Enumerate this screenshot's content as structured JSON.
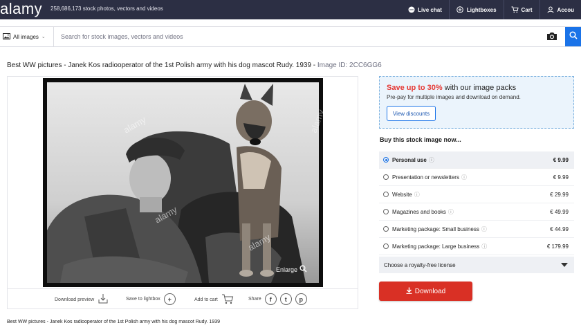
{
  "header": {
    "logo": "alamy",
    "tagline": "258,686,173 stock photos, vectors and videos",
    "nav": [
      {
        "icon": "chat-icon",
        "label": "Live chat"
      },
      {
        "icon": "plus-circle-icon",
        "label": "Lightboxes"
      },
      {
        "icon": "cart-icon",
        "label": "Cart"
      },
      {
        "icon": "user-icon",
        "label": "Accou"
      }
    ]
  },
  "search": {
    "category": "All images",
    "placeholder": "Search for stock images, vectors and videos",
    "camera_icon": "camera-icon",
    "search_icon": "search-icon"
  },
  "page": {
    "title": "Best WW pictures - Janek Kos radiooperator of the 1st Polish army with his dog mascot Rudy. 1939 - ",
    "image_id_label": "Image ID: 2CC6GG6",
    "caption": "Best WW pictures - Janek Kos radiooperator of the 1st Polish army with his dog mascot Rudy. 1939"
  },
  "image_panel": {
    "watermark": "alamy",
    "enlarge": "Enlarge",
    "actions": {
      "download_preview": "Download preview",
      "save_to_lightbox": "Save to lightbox",
      "add_to_cart": "Add to cart",
      "share": "Share"
    }
  },
  "promo": {
    "highlight": "Save up to 30%",
    "title_rest": " with our image packs",
    "subtitle": "Pre-pay for multiple images and download on demand.",
    "button": "View discounts"
  },
  "buy": {
    "heading": "Buy this stock image now...",
    "licenses": [
      {
        "label": "Personal use",
        "price": "€ 9.99",
        "selected": true
      },
      {
        "label": "Presentation or newsletters",
        "price": "€ 9.99",
        "selected": false
      },
      {
        "label": "Website",
        "price": "€ 29.99",
        "selected": false
      },
      {
        "label": "Magazines and books",
        "price": "€ 49.99",
        "selected": false
      },
      {
        "label": "Marketing package: Small business",
        "price": "€ 44.99",
        "selected": false
      },
      {
        "label": "Marketing package: Large business",
        "price": "€ 179.99",
        "selected": false
      }
    ],
    "royalty_free": "Choose a royalty-free license",
    "download": "Download"
  },
  "colors": {
    "topbar": "#2c2f44",
    "accent_blue": "#1a73e8",
    "download_red": "#d93025",
    "promo_red": "#e53935"
  }
}
